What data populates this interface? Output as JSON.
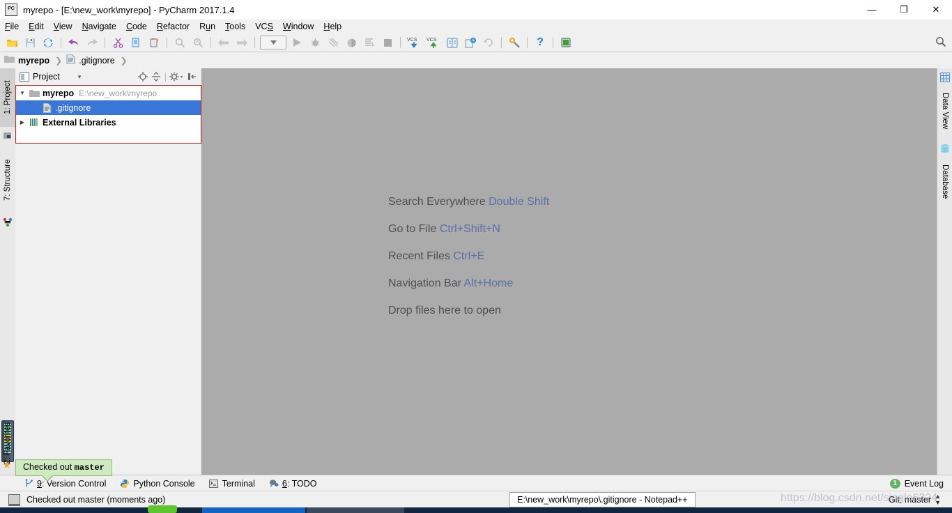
{
  "window": {
    "title": "myrepo - [E:\\new_work\\myrepo] - PyCharm 2017.1.4",
    "app_icon_label": "PC",
    "minimize": "—",
    "maximize": "❐",
    "close": "✕"
  },
  "menubar": {
    "items": [
      {
        "name": "file",
        "label": "File"
      },
      {
        "name": "edit",
        "label": "Edit"
      },
      {
        "name": "view",
        "label": "View"
      },
      {
        "name": "navigate",
        "label": "Navigate"
      },
      {
        "name": "code",
        "label": "Code"
      },
      {
        "name": "refactor",
        "label": "Refactor"
      },
      {
        "name": "run",
        "label": "Run"
      },
      {
        "name": "tools",
        "label": "Tools"
      },
      {
        "name": "vcs",
        "label": "VCS"
      },
      {
        "name": "window",
        "label": "Window"
      },
      {
        "name": "help",
        "label": "Help"
      }
    ]
  },
  "toolbar": {
    "icons": [
      "open-folder-icon",
      "save-all-icon",
      "sync-refresh-icon",
      "undo-icon",
      "redo-icon",
      "cut-icon",
      "copy-icon",
      "paste-icon",
      "find-icon",
      "replace-icon",
      "back-icon",
      "forward-icon",
      "run-config-dropdown",
      "run-icon",
      "debug-icon",
      "coverage-icon",
      "profile-icon",
      "run-console-icon",
      "stop-icon",
      "vcs-update-icon",
      "vcs-commit-icon",
      "vcs-diff-icon",
      "vcs-history-icon",
      "vcs-rollback-icon",
      "settings-wrench-icon",
      "help-icon",
      "save-chip-icon"
    ],
    "vcs_update_label": "VCS",
    "vcs_commit_label": "VCS",
    "help_label": "?",
    "search_icon": "search-icon"
  },
  "breadcrumb": {
    "items": [
      {
        "name": "crumb-myrepo",
        "label": "myrepo",
        "icon": "folder-icon",
        "bold": true
      },
      {
        "name": "crumb-gitignore",
        "label": ".gitignore",
        "icon": "file-icon",
        "bold": false
      }
    ],
    "separator": "❯"
  },
  "left_tool_tabs": [
    {
      "name": "sidebar-tab-project",
      "label": "1: Project",
      "num": "1",
      "rest": ": Project",
      "selected": true,
      "icon": "project-icon"
    },
    {
      "name": "sidebar-tab-structure",
      "label": "7: Structure",
      "num": "7",
      "rest": ": Structure",
      "selected": false,
      "icon": "structure-icon"
    },
    {
      "name": "sidebar-tab-favorites",
      "label": "2: Favorites",
      "num": "2",
      "rest": ": Favorites",
      "selected": false,
      "icon": "favorites-star-icon"
    }
  ],
  "right_tool_tabs": [
    {
      "name": "sidebar-tab-data-view",
      "label": "Data View",
      "icon": "grid-icon"
    },
    {
      "name": "sidebar-tab-database",
      "label": "Database",
      "icon": "database-icon"
    }
  ],
  "project_panel": {
    "title": "Project",
    "caret": "▾",
    "tools": [
      "locate-target-icon",
      "collapse-all-icon",
      "settings-gear-icon",
      "hide-panel-icon"
    ],
    "tree": [
      {
        "name": "tree-node-myrepo",
        "label": "myrepo",
        "path": "E:\\new_work\\myrepo",
        "twisty": "▼",
        "icon": "folder-icon",
        "bold": true,
        "selected": false,
        "indent": 0
      },
      {
        "name": "tree-node-gitignore",
        "label": ".gitignore",
        "path": "",
        "twisty": "",
        "icon": "file-icon",
        "bold": false,
        "selected": true,
        "indent": 1
      },
      {
        "name": "tree-node-external-libraries",
        "label": "External Libraries",
        "path": "",
        "twisty": "▶",
        "icon": "libraries-icon",
        "bold": true,
        "selected": false,
        "indent": 0
      }
    ]
  },
  "editor": {
    "hints": [
      {
        "name": "hint-search-everywhere",
        "text": "Search Everywhere",
        "key": "Double Shift"
      },
      {
        "name": "hint-go-to-file",
        "text": "Go to File",
        "key": "Ctrl+Shift+N"
      },
      {
        "name": "hint-recent-files",
        "text": "Recent Files",
        "key": "Ctrl+E"
      },
      {
        "name": "hint-navigation-bar",
        "text": "Navigation Bar",
        "key": "Alt+Home"
      },
      {
        "name": "hint-drop-files",
        "text": "Drop files here to open",
        "key": ""
      }
    ]
  },
  "bottom_tabs": [
    {
      "name": "bottom-tab-version-control",
      "num": "9",
      "rest": ": Version Control",
      "icon": "branch-icon"
    },
    {
      "name": "bottom-tab-python-console",
      "num": "",
      "rest": "Python Console",
      "icon": "python-icon"
    },
    {
      "name": "bottom-tab-terminal",
      "num": "",
      "rest": "Terminal",
      "icon": "terminal-icon"
    },
    {
      "name": "bottom-tab-todo",
      "num": "6",
      "rest": ": TODO",
      "icon": "todo-icon"
    }
  ],
  "event_log": {
    "count": "1",
    "label": "Event Log"
  },
  "statusbar": {
    "message": "Checked out master (moments ago)",
    "git_label": "Git: master",
    "git_caret": "⬍"
  },
  "balloon_tooltip": {
    "prefix": "Checked out ",
    "branch": "master"
  },
  "taskbar_tooltip": {
    "text": "E:\\new_work\\myrepo\\.gitignore - Notepad++"
  },
  "watermark": {
    "text": "https://blog.csdn.net/single6224",
    "text2": ""
  },
  "colors": {
    "selection_blue": "#3a76d8",
    "tree_border_red": "#c9241f",
    "editor_bg": "#ababab",
    "chrome_bg": "#f0f0f0",
    "hint_key": "#5b6fa8",
    "badge_green": "#63b363",
    "balloon_green": "#cfe9c0"
  }
}
